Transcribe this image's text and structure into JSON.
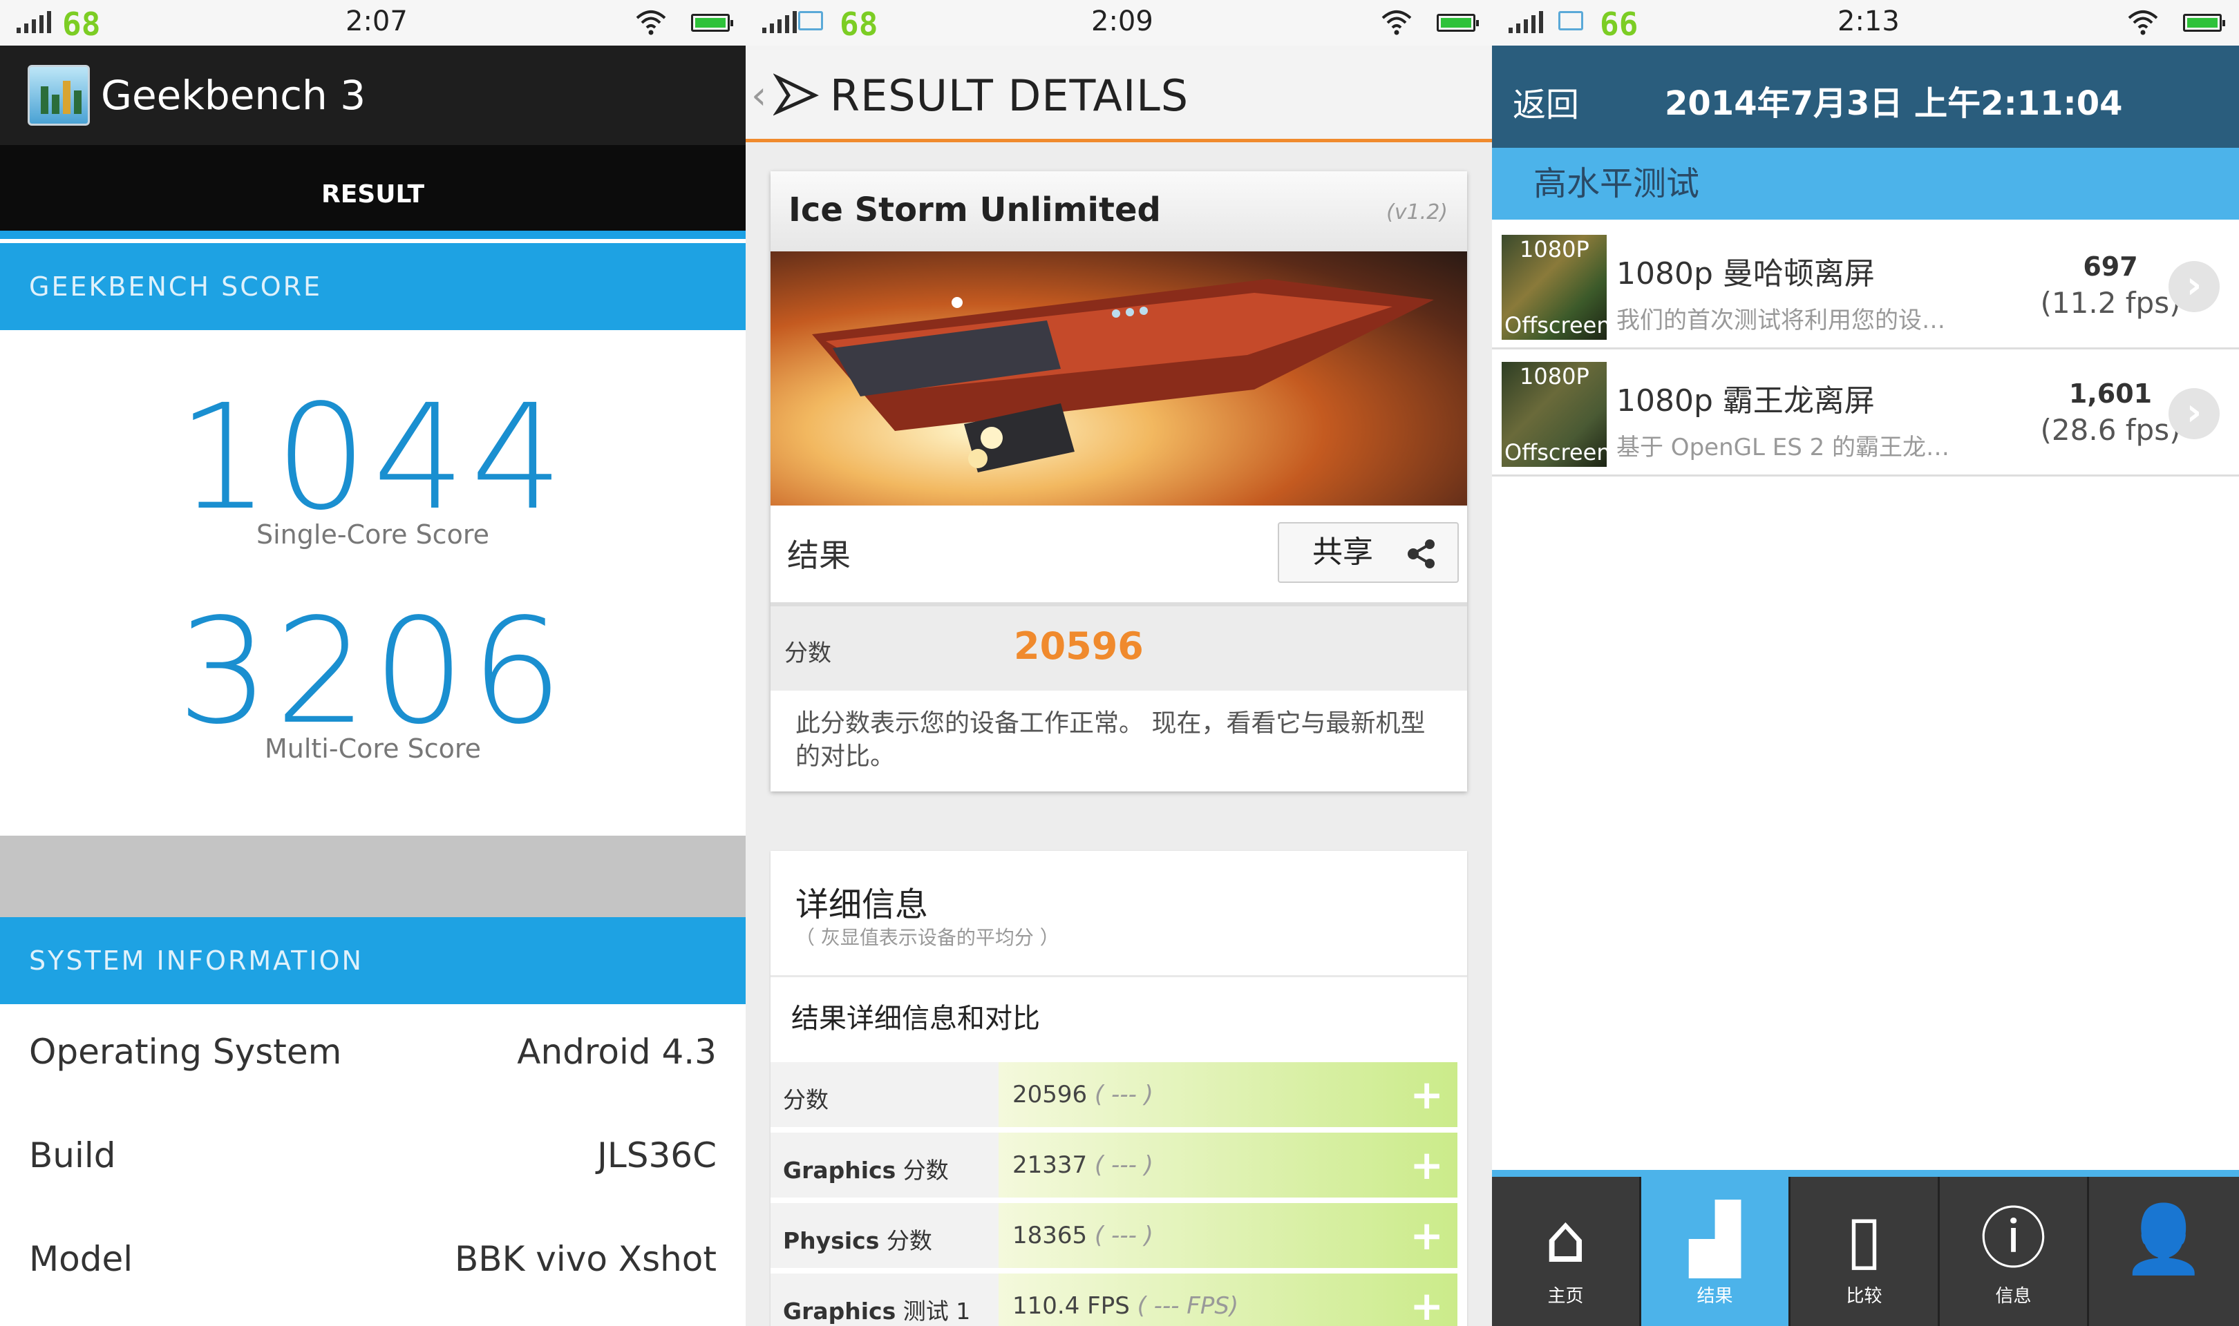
{
  "status": [
    {
      "battery": "68",
      "time": "2:07"
    },
    {
      "battery": "68",
      "time": "2:09"
    },
    {
      "battery": "66",
      "time": "2:13"
    }
  ],
  "geekbench": {
    "app_title": "Geekbench 3",
    "tab": "RESULT",
    "score_header": "GEEKBENCH SCORE",
    "single_score": "1044",
    "single_label": "Single-Core Score",
    "multi_score": "3206",
    "multi_label": "Multi-Core Score",
    "sysinfo_header": "SYSTEM INFORMATION",
    "rows": [
      {
        "k": "Operating System",
        "v": "Android 4.3"
      },
      {
        "k": "Build",
        "v": "JLS36C"
      },
      {
        "k": "Model",
        "v": "BBK vivo Xshot"
      }
    ]
  },
  "threedmark": {
    "title": "RESULT DETAILS",
    "test_name": "Ice Storm Unlimited",
    "version": "(v1.2)",
    "result_label": "结果",
    "share_label": "共享",
    "score_label": "分数",
    "score": "20596",
    "description": "此分数表示您的设备工作正常。 现在，看看它与最新机型的对比。",
    "details_title": "详细信息",
    "details_note": "（ 灰显值表示设备的平均分 ）",
    "compare_title": "结果详细信息和对比",
    "rows": [
      {
        "k_bold": "",
        "k": "分数",
        "v": "20596",
        "avg": "( --- )"
      },
      {
        "k_bold": "Graphics",
        "k": " 分数",
        "v": "21337",
        "avg": "( --- )"
      },
      {
        "k_bold": "Physics",
        "k": " 分数",
        "v": "18365",
        "avg": "( --- )"
      },
      {
        "k_bold": "Graphics",
        "k": " 测试 1",
        "v": "110.4 FPS",
        "avg": "( --- FPS)"
      }
    ]
  },
  "gfxbench": {
    "back": "返回",
    "datetime": "2014年7月3日 上午2:11:04",
    "section": "高水平测试",
    "items": [
      {
        "thumb_top": "1080P",
        "thumb_bottom": "Offscreen",
        "name": "1080p 曼哈顿离屏",
        "desc": "我们的首次测试将利用您的设…",
        "score": "697",
        "fps": "(11.2 fps)"
      },
      {
        "thumb_top": "1080P",
        "thumb_bottom": "Offscreen",
        "name": "1080p 霸王龙离屏",
        "desc": "基于 OpenGL ES 2 的霸王龙…",
        "score": "1,601",
        "fps": "(28.6 fps)"
      }
    ],
    "nav": [
      {
        "label": "主页",
        "icon": "home-icon",
        "glyph": "⌂"
      },
      {
        "label": "结果",
        "icon": "bar-chart-icon",
        "glyph": "▟"
      },
      {
        "label": "比较",
        "icon": "phone-icon",
        "glyph": "▯"
      },
      {
        "label": "信息",
        "icon": "info-icon",
        "glyph": "ⓘ"
      },
      {
        "label": "",
        "icon": "user-icon",
        "glyph": "👤"
      }
    ]
  },
  "colors": {
    "geek_blue": "#1ea2e3",
    "orange": "#f08a2d",
    "gfx_blue": "#4cb3ea",
    "gfx_dark": "#2a5d7d"
  }
}
